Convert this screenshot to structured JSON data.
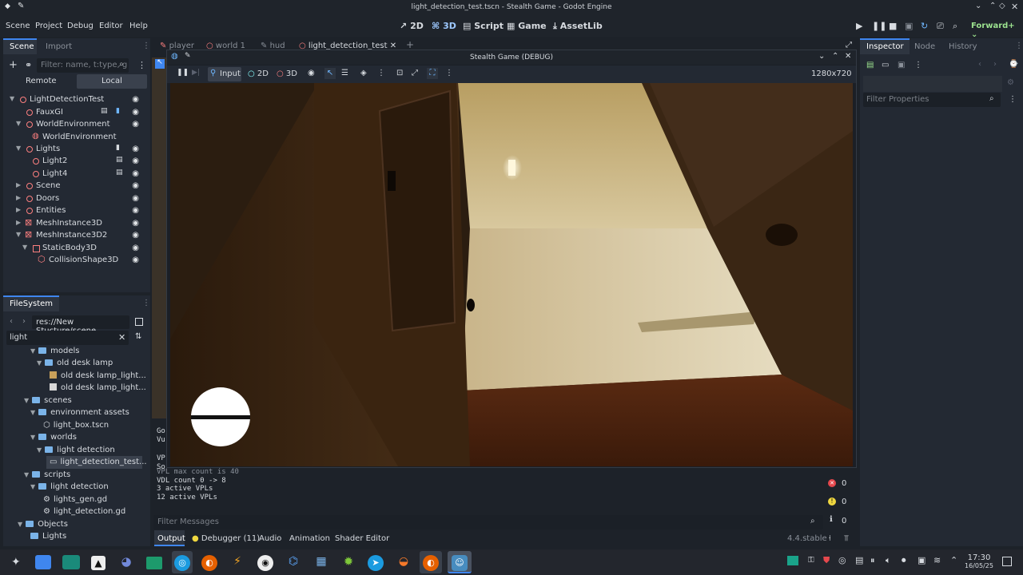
{
  "window": {
    "title": "light_detection_test.tscn - Stealth Game - Godot Engine"
  },
  "menubar": {
    "items": [
      "Scene",
      "Project",
      "Debug",
      "Editor",
      "Help"
    ],
    "workspaces": [
      "2D",
      "3D",
      "Script",
      "Game",
      "AssetLib"
    ],
    "active_workspace": "3D",
    "renderer": "Forward+"
  },
  "scene_dock": {
    "tabs": [
      "Scene",
      "Import"
    ],
    "filter_placeholder": "Filter: name, t:type, g",
    "remote_label": "Remote",
    "local_label": "Local",
    "tree": [
      {
        "label": "LightDetectionTest"
      },
      {
        "label": "FauxGI"
      },
      {
        "label": "WorldEnvironment"
      },
      {
        "label": "WorldEnvironment"
      },
      {
        "label": "Lights"
      },
      {
        "label": "Light2"
      },
      {
        "label": "Light4"
      },
      {
        "label": "Scene"
      },
      {
        "label": "Doors"
      },
      {
        "label": "Entities"
      },
      {
        "label": "MeshInstance3D"
      },
      {
        "label": "MeshInstance3D2"
      },
      {
        "label": "StaticBody3D"
      },
      {
        "label": "CollisionShape3D"
      }
    ]
  },
  "filesystem": {
    "title": "FileSystem",
    "path": "res://New Stucture/scene",
    "search_value": "light",
    "items": [
      {
        "label": "models"
      },
      {
        "label": "old desk lamp"
      },
      {
        "label": "old desk lamp_light..."
      },
      {
        "label": "old desk lamp_light..."
      },
      {
        "label": "scenes"
      },
      {
        "label": "environment assets"
      },
      {
        "label": "light_box.tscn"
      },
      {
        "label": "worlds"
      },
      {
        "label": "light detection"
      },
      {
        "label": "light_detection_test..."
      },
      {
        "label": "scripts"
      },
      {
        "label": "light detection"
      },
      {
        "label": "lights_gen.gd"
      },
      {
        "label": "light_detection.gd"
      },
      {
        "label": "Objects"
      },
      {
        "label": "Lights"
      }
    ]
  },
  "editor_tabs": [
    "player",
    "world 1",
    "hud",
    "light_detection_test"
  ],
  "game_window": {
    "title": "Stealth Game (DEBUG)",
    "input_label": "Input",
    "mode_2d": "2D",
    "mode_3d": "3D",
    "resolution": "1280x720"
  },
  "output": {
    "partial_lines": [
      "Go",
      "Vu",
      "VP",
      "So"
    ],
    "lines": [
      "VPL max count is 40",
      "VDL count 0 -> 8",
      "3 active VPLs",
      "12 active VPLs"
    ],
    "filter_placeholder": "Filter Messages",
    "errors": "0",
    "warnings": "0",
    "messages": "0"
  },
  "bottom_tabs": [
    "Output",
    "Debugger (11)",
    "Audio",
    "Animation",
    "Shader Editor"
  ],
  "version": "4.4.stable",
  "inspector": {
    "tabs": [
      "Inspector",
      "Node",
      "History"
    ],
    "filter_placeholder": "Filter Properties"
  },
  "taskbar": {
    "time": "17:30",
    "date": "16/05/25"
  },
  "colors": {
    "accent": "#3f86ef",
    "node3d": "#fc7f7f",
    "folder": "#7ab3e8",
    "bg": "#232933"
  }
}
